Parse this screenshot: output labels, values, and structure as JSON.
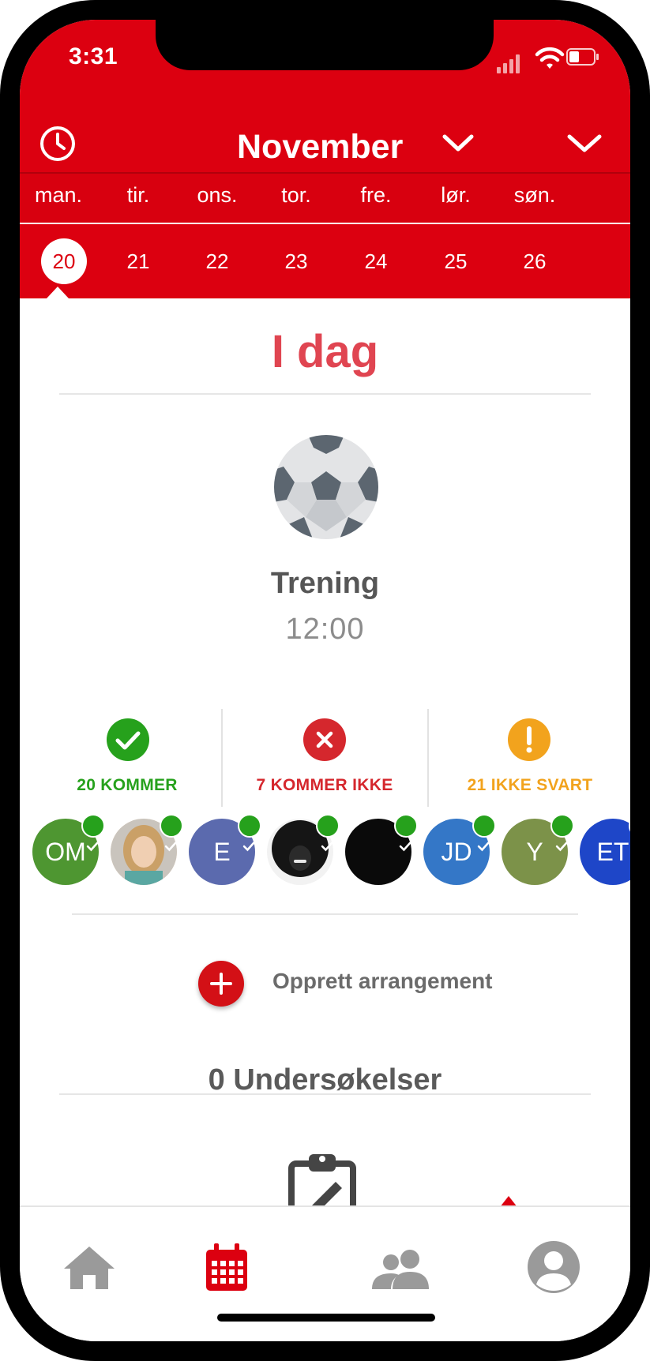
{
  "status_bar": {
    "time": "3:31"
  },
  "header": {
    "month": "November",
    "weekdays": [
      "man.",
      "tir.",
      "ons.",
      "tor.",
      "fre.",
      "lør.",
      "søn."
    ],
    "dates": [
      "20",
      "21",
      "22",
      "23",
      "24",
      "25",
      "26"
    ],
    "selected_date": "20",
    "accent_color": "#dc0010"
  },
  "day": {
    "title": "I dag"
  },
  "event": {
    "icon": "soccer-ball-icon",
    "title": "Trening",
    "time": "12:00"
  },
  "attendance": {
    "coming": {
      "label": "20 KOMMER",
      "icon": "check-icon",
      "color": "#26a11c"
    },
    "not_coming": {
      "label": "7 KOMMER IKKE",
      "icon": "x-icon",
      "color": "#d5272d"
    },
    "no_reply": {
      "label": "21 IKKE SVART",
      "icon": "exclamation-icon",
      "color": "#f2a31d"
    }
  },
  "avatars": [
    {
      "initials": "OM",
      "color": "#4e9631"
    },
    {
      "initials": "",
      "type": "photo"
    },
    {
      "initials": "E",
      "color": "#5b6aae"
    },
    {
      "initials": "",
      "type": "photo"
    },
    {
      "initials": "",
      "color": "#0a0a0a"
    },
    {
      "initials": "JD",
      "color": "#3477c7"
    },
    {
      "initials": "Y",
      "color": "#7c9249"
    },
    {
      "initials": "ET",
      "color": "#1e46c8"
    }
  ],
  "actions": {
    "create_event": "Opprett arrangement"
  },
  "surveys": {
    "count_label": "0 Undersøkelser"
  },
  "tabbar": {
    "tabs": [
      {
        "icon": "home-icon"
      },
      {
        "icon": "calendar-icon",
        "active": true
      },
      {
        "icon": "group-icon"
      },
      {
        "icon": "profile-icon"
      }
    ]
  }
}
